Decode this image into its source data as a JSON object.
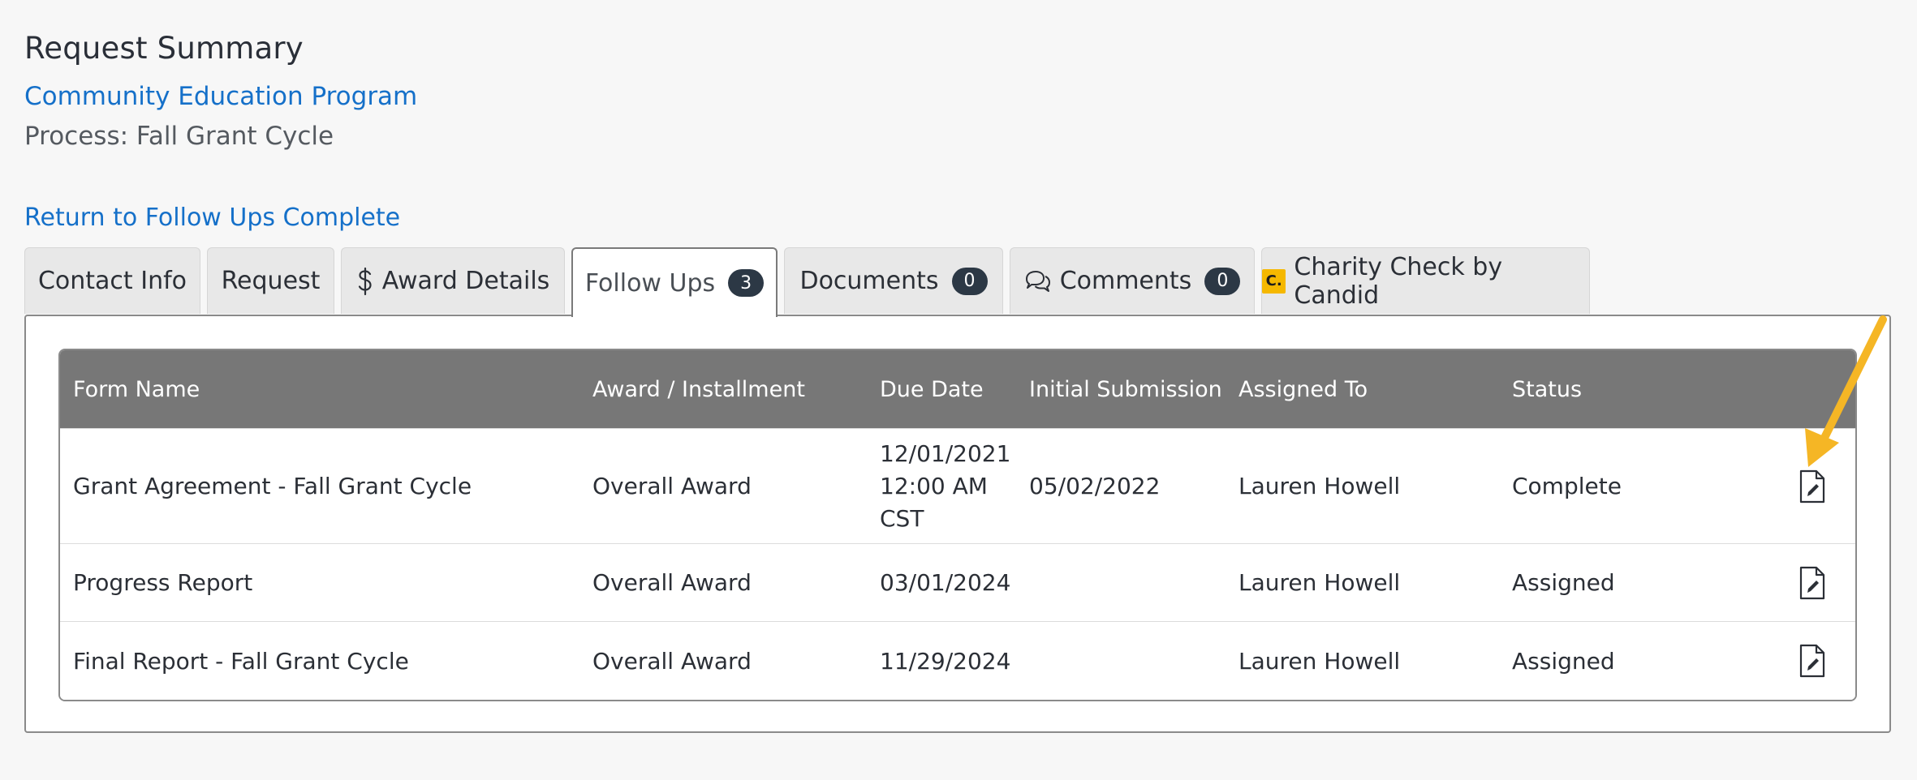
{
  "header": {
    "title": "Request Summary",
    "request_name": "Community Education Program",
    "process": "Process: Fall Grant Cycle",
    "return_link": "Return to Follow Ups Complete"
  },
  "tabs": [
    {
      "label": "Contact Info",
      "icon": null,
      "badge": null
    },
    {
      "label": "Request",
      "icon": null,
      "badge": null
    },
    {
      "label": "Award Details",
      "icon": "dollar-icon",
      "badge": null
    },
    {
      "label": "Follow Ups",
      "icon": null,
      "badge": "3",
      "active": true
    },
    {
      "label": "Documents",
      "icon": null,
      "badge": "0"
    },
    {
      "label": "Comments",
      "icon": "comments-icon",
      "badge": "0"
    },
    {
      "label": "Charity Check by Candid",
      "icon": "candid-logo",
      "badge": null,
      "logo_text": "C."
    }
  ],
  "table": {
    "columns": [
      "Form Name",
      "Award / Installment",
      "Due Date",
      "Initial Submission",
      "Assigned To",
      "Status"
    ],
    "rows": [
      {
        "form_name": "Grant Agreement - Fall Grant Cycle",
        "award": "Overall Award",
        "due_date_lines": [
          "12/01/2021",
          "12:00 AM",
          "CST"
        ],
        "initial_submission": "05/02/2022",
        "assigned_to": "Lauren Howell",
        "status": "Complete",
        "action_icon": "edit-document-icon"
      },
      {
        "form_name": "Progress Report",
        "award": "Overall Award",
        "due_date": "03/01/2024",
        "initial_submission": "",
        "assigned_to": "Lauren Howell",
        "status": "Assigned",
        "action_icon": "edit-document-icon"
      },
      {
        "form_name": "Final Report - Fall Grant Cycle",
        "award": "Overall Award",
        "due_date": "11/29/2024",
        "initial_submission": "",
        "assigned_to": "Lauren Howell",
        "status": "Assigned",
        "action_icon": "edit-document-icon"
      }
    ]
  },
  "colors": {
    "link": "#1570c9",
    "header_bg": "#777777",
    "badge_bg": "#2c3845",
    "arrow": "#f5b625",
    "candid_logo": "#f5b800"
  }
}
